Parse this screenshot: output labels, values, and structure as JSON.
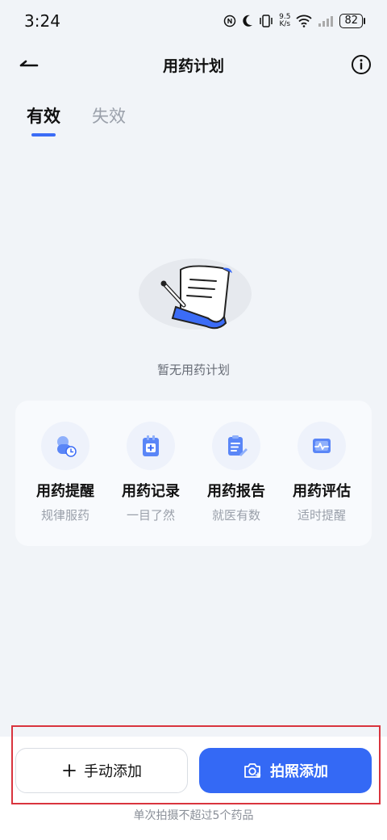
{
  "status_bar": {
    "time": "3:24",
    "net_speed_value": "9.5",
    "net_speed_unit": "K/s",
    "battery": "82"
  },
  "header": {
    "title": "用药计划"
  },
  "tabs": [
    {
      "label": "有效",
      "active": true
    },
    {
      "label": "失效",
      "active": false
    }
  ],
  "empty_state": {
    "text": "暂无用药计划"
  },
  "features": [
    {
      "title": "用药提醒",
      "subtitle": "规律服药",
      "icon": "pill-clock-icon"
    },
    {
      "title": "用药记录",
      "subtitle": "一目了然",
      "icon": "medical-record-icon"
    },
    {
      "title": "用药报告",
      "subtitle": "就医有数",
      "icon": "report-icon"
    },
    {
      "title": "用药评估",
      "subtitle": "适时提醒",
      "icon": "pulse-chart-icon"
    }
  ],
  "actions": {
    "manual_label": "手动添加",
    "photo_label": "拍照添加",
    "hint": "单次拍摄不超过5个药品"
  },
  "colors": {
    "accent": "#3469f5",
    "highlight_border": "#d9343e",
    "background": "#f1f4f8"
  }
}
